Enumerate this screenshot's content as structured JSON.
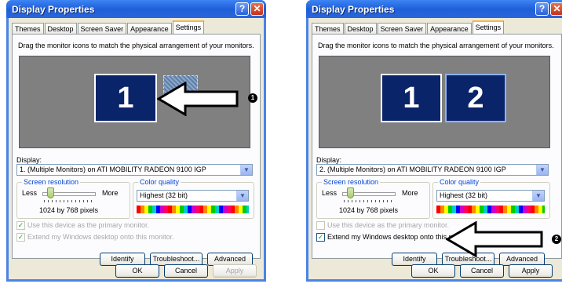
{
  "left": {
    "title": "Display Properties",
    "tabs": [
      "Themes",
      "Desktop",
      "Screen Saver",
      "Appearance",
      "Settings"
    ],
    "active_tab": "Settings",
    "instruction": "Drag the monitor icons to match the physical arrangement of your monitors.",
    "monitor1_label": "1",
    "display_label": "Display:",
    "display_value": "1. (Multiple Monitors) on ATI MOBILITY RADEON 9100 IGP",
    "resolution_title": "Screen resolution",
    "less": "Less",
    "more": "More",
    "resolution_value": "1024 by 768 pixels",
    "color_title": "Color quality",
    "color_value": "Highest (32 bit)",
    "primary_checkbox": "Use this device as the primary monitor.",
    "extend_checkbox": "Extend my Windows desktop onto this monitor.",
    "identify": "Identify",
    "troubleshoot": "Troubleshoot...",
    "advanced": "Advanced",
    "ok": "OK",
    "cancel": "Cancel",
    "apply": "Apply",
    "callout": "1"
  },
  "right": {
    "title": "Display Properties",
    "tabs": [
      "Themes",
      "Desktop",
      "Screen Saver",
      "Appearance",
      "Settings"
    ],
    "active_tab": "Settings",
    "instruction": "Drag the monitor icons to match the physical arrangement of your monitors.",
    "monitor1_label": "1",
    "monitor2_label": "2",
    "display_label": "Display:",
    "display_value": "2. (Multiple Monitors) on ATI MOBILITY RADEON 9100 IGP",
    "resolution_title": "Screen resolution",
    "less": "Less",
    "more": "More",
    "resolution_value": "1024 by 768 pixels",
    "color_title": "Color quality",
    "color_value": "Highest (32 bit)",
    "primary_checkbox": "Use this device as the primary monitor.",
    "extend_checkbox": "Extend my Windows desktop onto this monitor.",
    "identify": "Identify",
    "troubleshoot": "Troubleshoot...",
    "advanced": "Advanced",
    "ok": "OK",
    "cancel": "Cancel",
    "apply": "Apply",
    "callout": "2"
  },
  "icons": {
    "help": "question-mark",
    "close": "x",
    "dropdown": "chevron-down",
    "check": "checkmark"
  }
}
